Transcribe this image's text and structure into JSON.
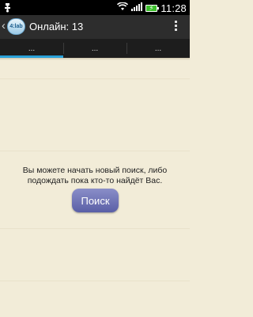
{
  "status_bar": {
    "time": "11:28",
    "icons": [
      "usb-debug-icon",
      "wifi-icon",
      "signal-icon",
      "battery-charging-icon"
    ]
  },
  "action_bar": {
    "title": "Онлайн: 13",
    "app_icon_text": "4:lab",
    "overflow_icon": "overflow-menu-icon"
  },
  "tabs": [
    {
      "label": "..."
    },
    {
      "label": "..."
    },
    {
      "label": "..."
    }
  ],
  "selected_tab": 0,
  "main": {
    "message": "Вы можете начать новый поиск, либо подождать пока кто-то найдёт Вас.",
    "search_button_label": "Поиск"
  },
  "colors": {
    "background": "#f2ecd8",
    "tab_indicator": "#2aa1d8",
    "button": "#6d72b6"
  }
}
